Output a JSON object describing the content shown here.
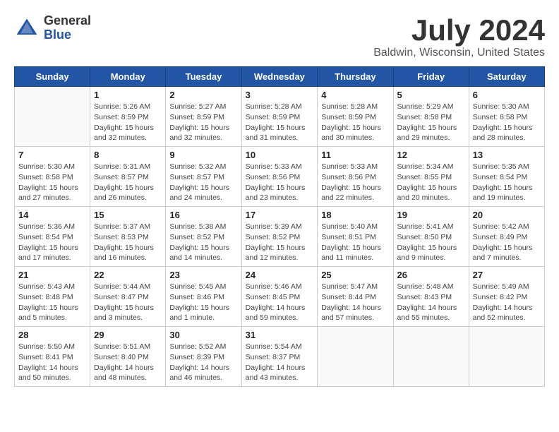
{
  "logo": {
    "general": "General",
    "blue": "Blue"
  },
  "title": "July 2024",
  "subtitle": "Baldwin, Wisconsin, United States",
  "headers": [
    "Sunday",
    "Monday",
    "Tuesday",
    "Wednesday",
    "Thursday",
    "Friday",
    "Saturday"
  ],
  "weeks": [
    [
      {
        "day": "",
        "info": ""
      },
      {
        "day": "1",
        "info": "Sunrise: 5:26 AM\nSunset: 8:59 PM\nDaylight: 15 hours\nand 32 minutes."
      },
      {
        "day": "2",
        "info": "Sunrise: 5:27 AM\nSunset: 8:59 PM\nDaylight: 15 hours\nand 32 minutes."
      },
      {
        "day": "3",
        "info": "Sunrise: 5:28 AM\nSunset: 8:59 PM\nDaylight: 15 hours\nand 31 minutes."
      },
      {
        "day": "4",
        "info": "Sunrise: 5:28 AM\nSunset: 8:59 PM\nDaylight: 15 hours\nand 30 minutes."
      },
      {
        "day": "5",
        "info": "Sunrise: 5:29 AM\nSunset: 8:58 PM\nDaylight: 15 hours\nand 29 minutes."
      },
      {
        "day": "6",
        "info": "Sunrise: 5:30 AM\nSunset: 8:58 PM\nDaylight: 15 hours\nand 28 minutes."
      }
    ],
    [
      {
        "day": "7",
        "info": "Sunrise: 5:30 AM\nSunset: 8:58 PM\nDaylight: 15 hours\nand 27 minutes."
      },
      {
        "day": "8",
        "info": "Sunrise: 5:31 AM\nSunset: 8:57 PM\nDaylight: 15 hours\nand 26 minutes."
      },
      {
        "day": "9",
        "info": "Sunrise: 5:32 AM\nSunset: 8:57 PM\nDaylight: 15 hours\nand 24 minutes."
      },
      {
        "day": "10",
        "info": "Sunrise: 5:33 AM\nSunset: 8:56 PM\nDaylight: 15 hours\nand 23 minutes."
      },
      {
        "day": "11",
        "info": "Sunrise: 5:33 AM\nSunset: 8:56 PM\nDaylight: 15 hours\nand 22 minutes."
      },
      {
        "day": "12",
        "info": "Sunrise: 5:34 AM\nSunset: 8:55 PM\nDaylight: 15 hours\nand 20 minutes."
      },
      {
        "day": "13",
        "info": "Sunrise: 5:35 AM\nSunset: 8:54 PM\nDaylight: 15 hours\nand 19 minutes."
      }
    ],
    [
      {
        "day": "14",
        "info": "Sunrise: 5:36 AM\nSunset: 8:54 PM\nDaylight: 15 hours\nand 17 minutes."
      },
      {
        "day": "15",
        "info": "Sunrise: 5:37 AM\nSunset: 8:53 PM\nDaylight: 15 hours\nand 16 minutes."
      },
      {
        "day": "16",
        "info": "Sunrise: 5:38 AM\nSunset: 8:52 PM\nDaylight: 15 hours\nand 14 minutes."
      },
      {
        "day": "17",
        "info": "Sunrise: 5:39 AM\nSunset: 8:52 PM\nDaylight: 15 hours\nand 12 minutes."
      },
      {
        "day": "18",
        "info": "Sunrise: 5:40 AM\nSunset: 8:51 PM\nDaylight: 15 hours\nand 11 minutes."
      },
      {
        "day": "19",
        "info": "Sunrise: 5:41 AM\nSunset: 8:50 PM\nDaylight: 15 hours\nand 9 minutes."
      },
      {
        "day": "20",
        "info": "Sunrise: 5:42 AM\nSunset: 8:49 PM\nDaylight: 15 hours\nand 7 minutes."
      }
    ],
    [
      {
        "day": "21",
        "info": "Sunrise: 5:43 AM\nSunset: 8:48 PM\nDaylight: 15 hours\nand 5 minutes."
      },
      {
        "day": "22",
        "info": "Sunrise: 5:44 AM\nSunset: 8:47 PM\nDaylight: 15 hours\nand 3 minutes."
      },
      {
        "day": "23",
        "info": "Sunrise: 5:45 AM\nSunset: 8:46 PM\nDaylight: 15 hours\nand 1 minute."
      },
      {
        "day": "24",
        "info": "Sunrise: 5:46 AM\nSunset: 8:45 PM\nDaylight: 14 hours\nand 59 minutes."
      },
      {
        "day": "25",
        "info": "Sunrise: 5:47 AM\nSunset: 8:44 PM\nDaylight: 14 hours\nand 57 minutes."
      },
      {
        "day": "26",
        "info": "Sunrise: 5:48 AM\nSunset: 8:43 PM\nDaylight: 14 hours\nand 55 minutes."
      },
      {
        "day": "27",
        "info": "Sunrise: 5:49 AM\nSunset: 8:42 PM\nDaylight: 14 hours\nand 52 minutes."
      }
    ],
    [
      {
        "day": "28",
        "info": "Sunrise: 5:50 AM\nSunset: 8:41 PM\nDaylight: 14 hours\nand 50 minutes."
      },
      {
        "day": "29",
        "info": "Sunrise: 5:51 AM\nSunset: 8:40 PM\nDaylight: 14 hours\nand 48 minutes."
      },
      {
        "day": "30",
        "info": "Sunrise: 5:52 AM\nSunset: 8:39 PM\nDaylight: 14 hours\nand 46 minutes."
      },
      {
        "day": "31",
        "info": "Sunrise: 5:54 AM\nSunset: 8:37 PM\nDaylight: 14 hours\nand 43 minutes."
      },
      {
        "day": "",
        "info": ""
      },
      {
        "day": "",
        "info": ""
      },
      {
        "day": "",
        "info": ""
      }
    ]
  ]
}
